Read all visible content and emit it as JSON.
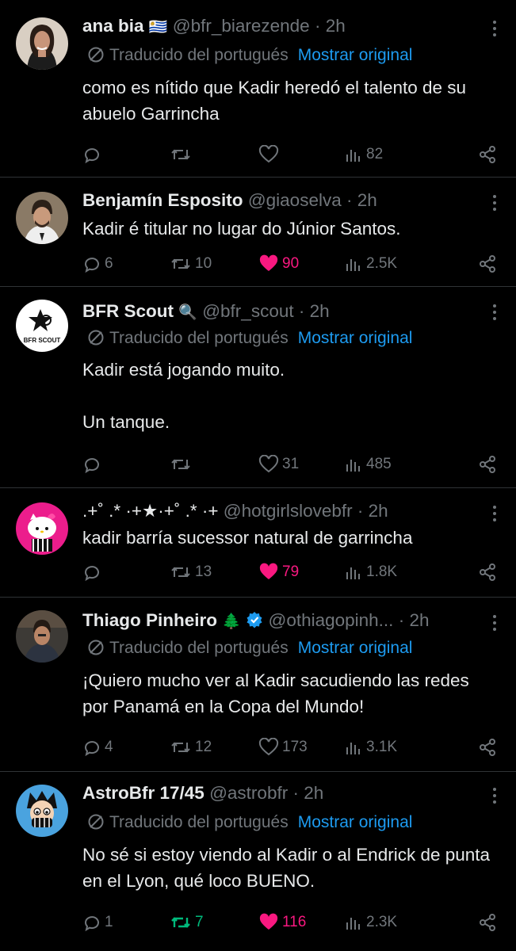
{
  "translate_label": "Traducido del portugués",
  "show_original_label": "Mostrar original",
  "colors": {
    "background": "#000000",
    "secondary": "#71767b",
    "link": "#1d9bf0",
    "like": "#f91880",
    "retweet": "#00ba7c",
    "verified": "#1d9bf0"
  },
  "tweets": [
    {
      "name": "ana bia",
      "name_emoji": "🇺🇾",
      "handle": "@bfr_biarezende",
      "time": "2h",
      "translated": true,
      "text": [
        "como es nítido que Kadir heredó el talento de su abuelo Garrincha"
      ],
      "replies": "",
      "retweets": "",
      "likes": "",
      "views": "82"
    },
    {
      "name": "Benjamín Esposito",
      "handle": "@giaoselva",
      "time": "2h",
      "translated": false,
      "text": [
        "Kadir é titular no lugar do Júnior Santos."
      ],
      "replies": "6",
      "retweets": "10",
      "likes": "90",
      "liked": true,
      "views": "2.5K"
    },
    {
      "name": "BFR Scout",
      "name_emoji": "🔍",
      "handle": "@bfr_scout",
      "time": "2h",
      "translated": true,
      "text": [
        "Kadir está jogando muito.",
        "Un tanque."
      ],
      "replies": "",
      "retweets": "",
      "likes": "31",
      "views": "485",
      "avatar_label": "BFR SCOUT"
    },
    {
      "name": ".+˚ .* ·+★·+˚ .* ·+",
      "handle": "@hotgirlslovebfr",
      "time": "2h",
      "translated": false,
      "text": [
        "kadir barría sucessor natural de garrincha"
      ],
      "replies": "",
      "retweets": "13",
      "likes": "79",
      "liked": true,
      "views": "1.8K"
    },
    {
      "name": "Thiago Pinheiro",
      "name_emoji": "🌲",
      "verified": true,
      "handle": "@othiagopinh...",
      "time": "2h",
      "translated": true,
      "text": [
        "¡Quiero mucho ver al Kadir sacudiendo las redes por Panamá en la Copa del Mundo!"
      ],
      "replies": "4",
      "retweets": "12",
      "likes": "173",
      "views": "3.1K"
    },
    {
      "name": "AstroBfr 17/45",
      "handle": "@astrobfr",
      "time": "2h",
      "translated": true,
      "text": [
        "No sé si estoy viendo al Kadir o al Endrick de punta en el Lyon, qué loco BUENO."
      ],
      "replies": "1",
      "retweets": "7",
      "retweeted": true,
      "likes": "116",
      "liked": true,
      "views": "2.3K"
    }
  ]
}
